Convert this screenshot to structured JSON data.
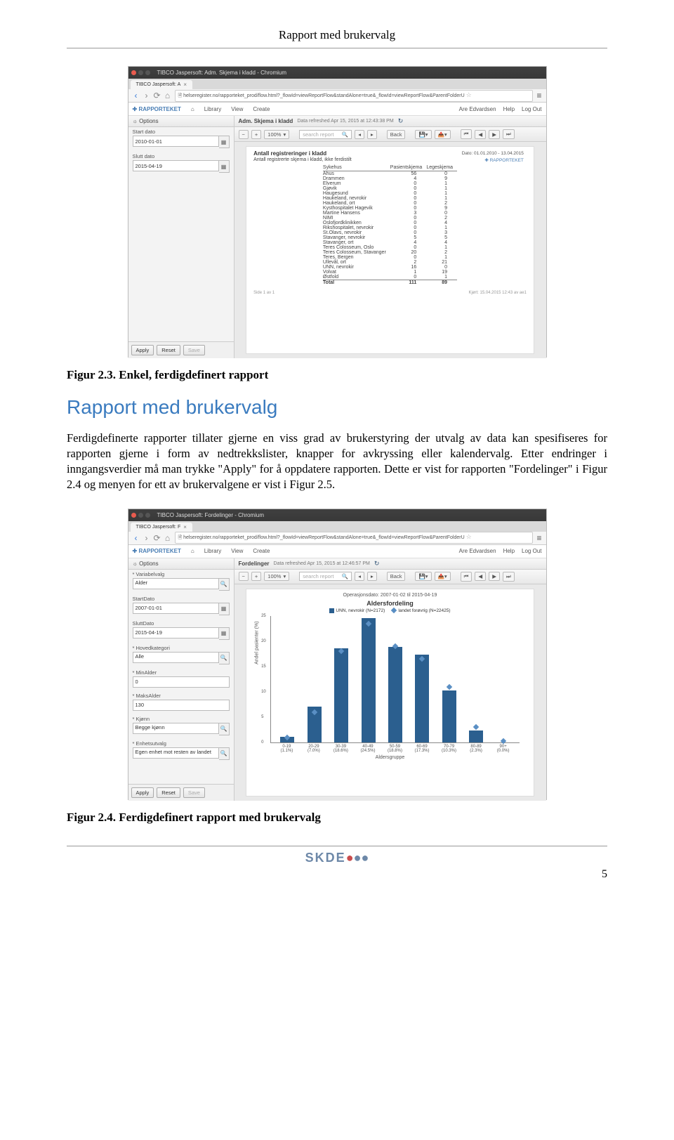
{
  "header": {
    "running_title": "Rapport med brukervalg"
  },
  "captions": {
    "fig_2_3": "Figur 2.3. Enkel, ferdigdefinert rapport",
    "fig_2_4": "Figur 2.4. Ferdigdefinert rapport med brukervalg"
  },
  "section_heading": "Rapport med brukervalg",
  "body_paragraph": "Ferdigdefinerte rapporter tillater gjerne en viss grad av brukerstyring der utvalg av data kan spesifiseres for rapporten gjerne i form av nedtrekkslister, knapper for avkryssing eller kalendervalg. Etter endringer i inngangsverdier må man trykke \"Apply\" for å oppdatere rapporten. Dette er vist for rapporten \"Fordelinger\" i Figur 2.4 og menyen for ett av brukervalgene er vist i Figur 2.5.",
  "browser_common": {
    "url": "helseregister.no/rapporteket_prod/flow.html?_flowId=viewReportFlow&standAlone=true&_flowId=viewReportFlow&ParentFolderU",
    "menubar": {
      "brand": "RAPPORTEKET",
      "items": [
        "Library",
        "View",
        "Create"
      ],
      "right": [
        "Are Edvardsen",
        "Help",
        "Log Out"
      ]
    },
    "options_label": "Options",
    "buttons": {
      "apply": "Apply",
      "reset": "Reset",
      "save": "Save"
    },
    "toolbar": {
      "zoom": "100%",
      "search_ph": "search report",
      "back": "Back"
    }
  },
  "screenshot1": {
    "window_title": "TIBCO Jaspersoft: Adm. Skjema i kladd - Chromium",
    "tab_title": "TIBCO Jaspersoft: A",
    "sidebar": {
      "start_label": "Start dato",
      "start_value": "2010-01-01",
      "end_label": "Slutt dato",
      "end_value": "2015-04-19"
    },
    "report_hdr": {
      "title": "Adm. Skjema i kladd",
      "meta": "Data refreshed Apr 15, 2015 at 12:43:38 PM"
    },
    "report": {
      "title": "Antall registreringer i kladd",
      "subtitle": "Antall registrerte skjema i kladd, ikke ferdistilt",
      "dato": "Dato: 01.01.2010 - 13.04.2015",
      "brand": "RAPPORTEKET",
      "columns": [
        "Sykehus",
        "Pasientskjema",
        "Legeskjema"
      ],
      "rows": [
        [
          "Ahus",
          56,
          0
        ],
        [
          "Drammen",
          4,
          9
        ],
        [
          "Elverum",
          0,
          1
        ],
        [
          "Gjøvik",
          0,
          1
        ],
        [
          "Haugesund",
          0,
          1
        ],
        [
          "Haukeland, nevrokir",
          0,
          1
        ],
        [
          "Haukeland, ort",
          0,
          2
        ],
        [
          "Kysthospitalet Hagevik",
          0,
          9
        ],
        [
          "Martine Hansens",
          3,
          0
        ],
        [
          "NIMI",
          0,
          2
        ],
        [
          "Oslofjordklinikken",
          0,
          4
        ],
        [
          "Rikshospitalet, nevrokir",
          0,
          1
        ],
        [
          "St.Olavs, nevrokir",
          0,
          3
        ],
        [
          "Stavanger, nevrokir",
          5,
          5
        ],
        [
          "Stavanger, ort",
          4,
          4
        ],
        [
          "Teres Colosseum, Oslo",
          0,
          1
        ],
        [
          "Teres Colosseum, Stavanger",
          20,
          2
        ],
        [
          "Teres, Bergen",
          0,
          1
        ],
        [
          "Ullevål, ort",
          2,
          21
        ],
        [
          "UNN, nevrokir",
          16,
          0
        ],
        [
          "Volvat",
          1,
          19
        ],
        [
          "Østfold",
          0,
          1
        ]
      ],
      "total_row": [
        "Total",
        111,
        89
      ],
      "footer_left": "Side 1 av 1",
      "footer_right": "Kjørt: 15.04.2015 12:43 av ae1"
    }
  },
  "screenshot2": {
    "window_title": "TIBCO Jaspersoft: Fordelinger - Chromium",
    "tab_title": "TIBCO Jaspersoft: F",
    "sidebar": [
      {
        "label": "* Variabelvalg",
        "value": "Alder",
        "type": "select"
      },
      {
        "label": "StartDato",
        "value": "2007-01-01",
        "type": "date"
      },
      {
        "label": "SluttDato",
        "value": "2015-04-19",
        "type": "date"
      },
      {
        "label": "* Hovedkategori",
        "value": "Alle",
        "type": "select"
      },
      {
        "label": "* MinAlder",
        "value": "0",
        "type": "text"
      },
      {
        "label": "* MaksAlder",
        "value": "130",
        "type": "text"
      },
      {
        "label": "* Kjønn",
        "value": "Begge kjønn",
        "type": "select"
      },
      {
        "label": "* Enhetsutvalg",
        "value": "Egen enhet mot resten av landet",
        "type": "select"
      }
    ],
    "report_hdr": {
      "title": "Fordelinger",
      "meta": "Data refreshed Apr 15, 2015 at 12:46:57 PM"
    },
    "chart": {
      "date_range": "Operasjonsdato: 2007-01-02 til 2015-04-19",
      "title": "Aldersfordeling",
      "legend": [
        {
          "label": "UNN, nevrokir (N=2172)",
          "kind": "bar",
          "color": "#2b5f8f"
        },
        {
          "label": "landet forøvrig (N=22425)",
          "kind": "diamond",
          "color": "#5a8fc4"
        }
      ],
      "y_label": "Andel pasienter (%)",
      "x_label": "Aldersgruppe"
    }
  },
  "chart_data": {
    "type": "bar",
    "categories": [
      "0-19",
      "20-29",
      "30-39",
      "40-49",
      "50-59",
      "60-69",
      "70-79",
      "80-89",
      "90+"
    ],
    "series": [
      {
        "name": "UNN, nevrokir (N=2172)",
        "kind": "bar",
        "color": "#2b5f8f",
        "values": [
          1.1,
          7.0,
          18.6,
          24.5,
          18.8,
          17.3,
          10.3,
          2.3,
          0.0
        ]
      },
      {
        "name": "landet forøvrig (N=22425)",
        "kind": "diamond",
        "color": "#5a8fc4",
        "values": [
          1.0,
          6.0,
          18.0,
          23.5,
          19.0,
          16.5,
          11.0,
          3.0,
          0.2
        ]
      }
    ],
    "x_percent_labels": [
      "(1.1%)",
      "(7.0%)",
      "(18.6%)",
      "(24.5%)",
      "(18.8%)",
      "(17.3%)",
      "(10.3%)",
      "(2.3%)",
      "(0.0%)"
    ],
    "ylabel": "Andel pasienter (%)",
    "xlabel": "Aldersgruppe",
    "ylim": [
      0,
      25
    ],
    "yticks": [
      0,
      5,
      10,
      15,
      20,
      25
    ],
    "title": "Aldersfordeling"
  },
  "footer": {
    "logo": "SKDE",
    "page_num": "5"
  }
}
